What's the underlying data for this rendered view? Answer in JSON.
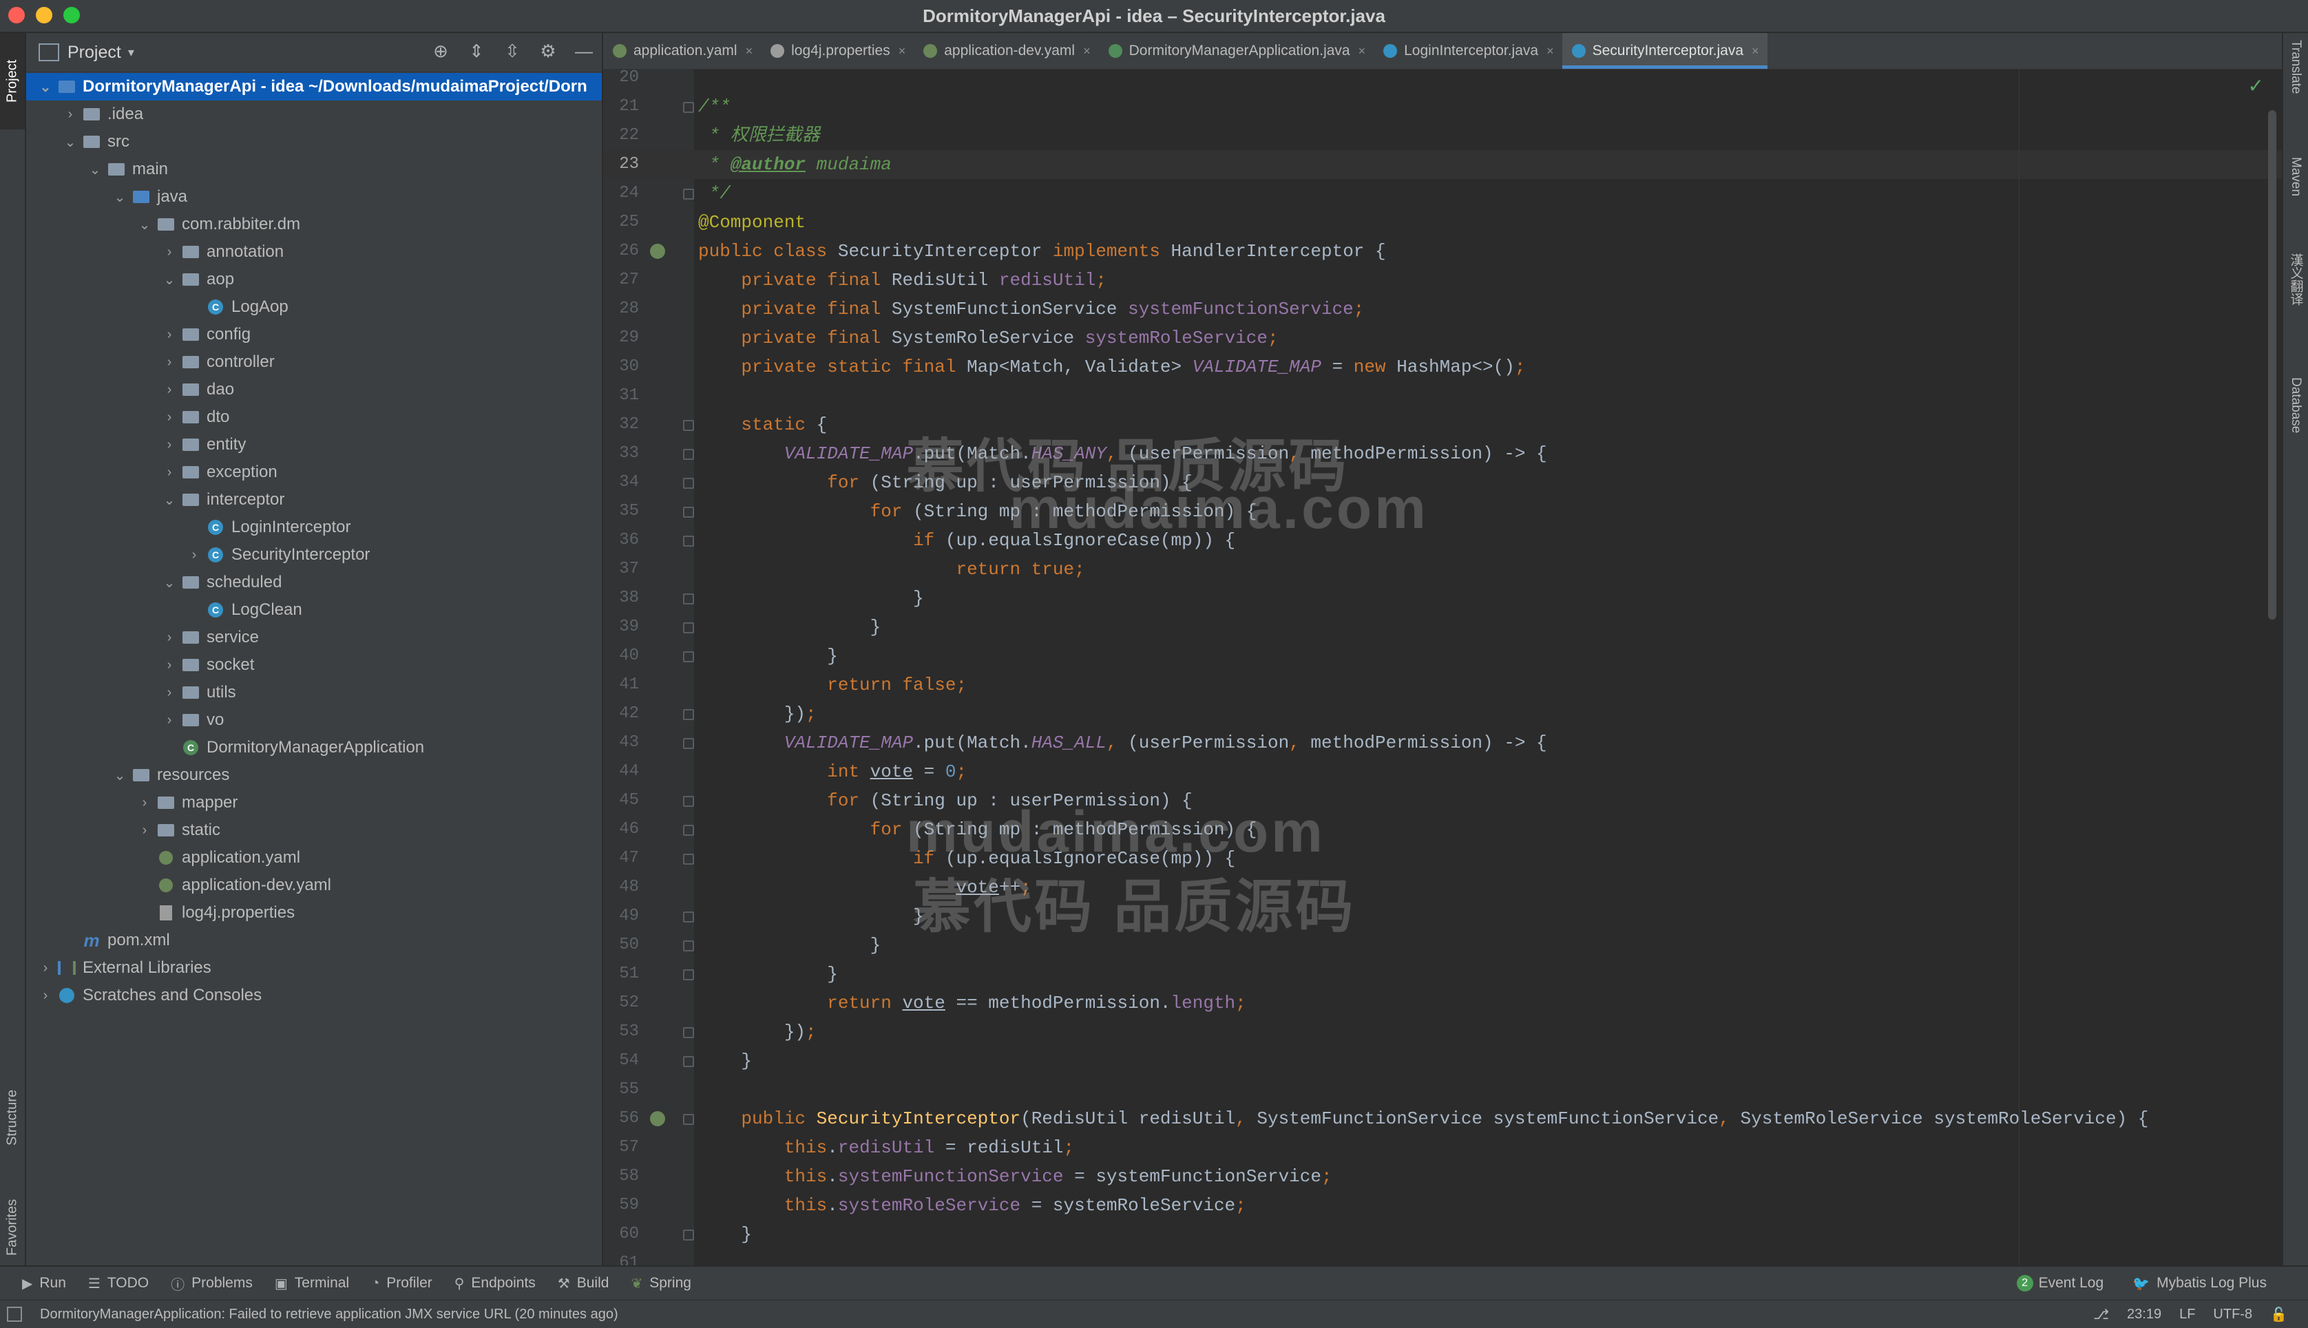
{
  "window": {
    "title": "DormitoryManagerApi - idea – SecurityInterceptor.java",
    "traffic_colors": [
      "#fe5f57",
      "#febc2e",
      "#28c840"
    ]
  },
  "left_stripe": {
    "project": "Project",
    "structure": "Structure",
    "favorites": "Favorites"
  },
  "right_stripe": {
    "translate": "Translate",
    "maven": "Maven",
    "fanyi": "漢义翻译",
    "database": "Database"
  },
  "project_panel": {
    "title": "Project",
    "tree": [
      {
        "depth": 0,
        "arrow": "open",
        "icon": "module",
        "label": "DormitoryManagerApi - idea ~/Downloads/mudaimaProject/Dorn",
        "selected": true
      },
      {
        "depth": 1,
        "arrow": "closed",
        "icon": "folder",
        "label": ".idea"
      },
      {
        "depth": 1,
        "arrow": "open",
        "icon": "folder",
        "label": "src"
      },
      {
        "depth": 2,
        "arrow": "open",
        "icon": "folder",
        "label": "main"
      },
      {
        "depth": 3,
        "arrow": "open",
        "icon": "folder-blue",
        "label": "java"
      },
      {
        "depth": 4,
        "arrow": "open",
        "icon": "folder",
        "label": "com.rabbiter.dm"
      },
      {
        "depth": 5,
        "arrow": "closed",
        "icon": "folder",
        "label": "annotation"
      },
      {
        "depth": 5,
        "arrow": "open",
        "icon": "folder",
        "label": "aop"
      },
      {
        "depth": 6,
        "arrow": "none",
        "icon": "class",
        "label": "LogAop"
      },
      {
        "depth": 5,
        "arrow": "closed",
        "icon": "folder",
        "label": "config"
      },
      {
        "depth": 5,
        "arrow": "closed",
        "icon": "folder",
        "label": "controller"
      },
      {
        "depth": 5,
        "arrow": "closed",
        "icon": "folder",
        "label": "dao"
      },
      {
        "depth": 5,
        "arrow": "closed",
        "icon": "folder",
        "label": "dto"
      },
      {
        "depth": 5,
        "arrow": "closed",
        "icon": "folder",
        "label": "entity"
      },
      {
        "depth": 5,
        "arrow": "closed",
        "icon": "folder",
        "label": "exception"
      },
      {
        "depth": 5,
        "arrow": "open",
        "icon": "folder",
        "label": "interceptor"
      },
      {
        "depth": 6,
        "arrow": "none",
        "icon": "class",
        "label": "LoginInterceptor"
      },
      {
        "depth": 6,
        "arrow": "closed",
        "icon": "class",
        "label": "SecurityInterceptor"
      },
      {
        "depth": 5,
        "arrow": "open",
        "icon": "folder",
        "label": "scheduled"
      },
      {
        "depth": 6,
        "arrow": "none",
        "icon": "class",
        "label": "LogClean"
      },
      {
        "depth": 5,
        "arrow": "closed",
        "icon": "folder",
        "label": "service"
      },
      {
        "depth": 5,
        "arrow": "closed",
        "icon": "folder",
        "label": "socket"
      },
      {
        "depth": 5,
        "arrow": "closed",
        "icon": "folder",
        "label": "utils"
      },
      {
        "depth": 5,
        "arrow": "closed",
        "icon": "folder",
        "label": "vo"
      },
      {
        "depth": 5,
        "arrow": "none",
        "icon": "spring-class",
        "label": "DormitoryManagerApplication"
      },
      {
        "depth": 3,
        "arrow": "open",
        "icon": "folder-res",
        "label": "resources"
      },
      {
        "depth": 4,
        "arrow": "closed",
        "icon": "folder",
        "label": "mapper"
      },
      {
        "depth": 4,
        "arrow": "closed",
        "icon": "folder",
        "label": "static"
      },
      {
        "depth": 4,
        "arrow": "none",
        "icon": "yaml",
        "label": "application.yaml"
      },
      {
        "depth": 4,
        "arrow": "none",
        "icon": "yaml",
        "label": "application-dev.yaml"
      },
      {
        "depth": 4,
        "arrow": "none",
        "icon": "properties",
        "label": "log4j.properties"
      },
      {
        "depth": 1,
        "arrow": "none",
        "icon": "pom",
        "label": "pom.xml"
      },
      {
        "depth": 0,
        "arrow": "closed",
        "icon": "library",
        "label": "External Libraries"
      },
      {
        "depth": 0,
        "arrow": "closed",
        "icon": "scratch",
        "label": "Scratches and Consoles"
      }
    ]
  },
  "tabs": [
    {
      "label": "application.yaml",
      "icon": "yaml",
      "active": false
    },
    {
      "label": "log4j.properties",
      "icon": "properties",
      "active": false
    },
    {
      "label": "application-dev.yaml",
      "icon": "yaml",
      "active": false
    },
    {
      "label": "DormitoryManagerApplication.java",
      "icon": "spring-class",
      "active": false
    },
    {
      "label": "LoginInterceptor.java",
      "icon": "class",
      "active": false
    },
    {
      "label": "SecurityInterceptor.java",
      "icon": "class",
      "active": true
    }
  ],
  "editor": {
    "current_line": 23,
    "lines": [
      {
        "n": 20,
        "fold": false,
        "gutter": "",
        "tokens": []
      },
      {
        "n": 21,
        "fold": true,
        "gutter": "",
        "tokens": [
          [
            "doc",
            "/**"
          ]
        ]
      },
      {
        "n": 22,
        "fold": false,
        "gutter": "",
        "tokens": [
          [
            "doc",
            " * 权限拦截器"
          ]
        ]
      },
      {
        "n": 23,
        "fold": false,
        "gutter": "",
        "tokens": [
          [
            "doc",
            " * "
          ],
          [
            "tag",
            "@author"
          ],
          [
            "doc",
            " mudaima"
          ]
        ]
      },
      {
        "n": 24,
        "fold": true,
        "gutter": "",
        "tokens": [
          [
            "doc",
            " */"
          ]
        ]
      },
      {
        "n": 25,
        "fold": false,
        "gutter": "",
        "tokens": [
          [
            "ann",
            "@Component"
          ]
        ]
      },
      {
        "n": 26,
        "fold": false,
        "gutter": "bean",
        "tokens": [
          [
            "kw",
            "public class "
          ],
          [
            "plain",
            "SecurityInterceptor "
          ],
          [
            "kw",
            "implements "
          ],
          [
            "plain",
            "HandlerInterceptor {"
          ]
        ]
      },
      {
        "n": 27,
        "fold": false,
        "gutter": "",
        "tokens": [
          [
            "plain",
            "    "
          ],
          [
            "kw",
            "private final "
          ],
          [
            "plain",
            "RedisUtil "
          ],
          [
            "fld",
            "redisUtil"
          ],
          [
            "kw",
            ";"
          ]
        ]
      },
      {
        "n": 28,
        "fold": false,
        "gutter": "",
        "tokens": [
          [
            "plain",
            "    "
          ],
          [
            "kw",
            "private final "
          ],
          [
            "plain",
            "SystemFunctionService "
          ],
          [
            "fld",
            "systemFunctionService"
          ],
          [
            "kw",
            ";"
          ]
        ]
      },
      {
        "n": 29,
        "fold": false,
        "gutter": "",
        "tokens": [
          [
            "plain",
            "    "
          ],
          [
            "kw",
            "private final "
          ],
          [
            "plain",
            "SystemRoleService "
          ],
          [
            "fld",
            "systemRoleService"
          ],
          [
            "kw",
            ";"
          ]
        ]
      },
      {
        "n": 30,
        "fold": false,
        "gutter": "",
        "tokens": [
          [
            "plain",
            "    "
          ],
          [
            "kw",
            "private static final "
          ],
          [
            "plain",
            "Map<Match, Validate> "
          ],
          [
            "sfld",
            "VALIDATE_MAP"
          ],
          [
            "plain",
            " = "
          ],
          [
            "kw",
            "new "
          ],
          [
            "plain",
            "HashMap<>()"
          ],
          [
            "kw",
            ";"
          ]
        ]
      },
      {
        "n": 31,
        "fold": false,
        "gutter": "",
        "tokens": []
      },
      {
        "n": 32,
        "fold": true,
        "gutter": "",
        "tokens": [
          [
            "plain",
            "    "
          ],
          [
            "kw",
            "static "
          ],
          [
            "plain",
            "{"
          ]
        ]
      },
      {
        "n": 33,
        "fold": true,
        "gutter": "",
        "tokens": [
          [
            "plain",
            "        "
          ],
          [
            "sfld",
            "VALIDATE_MAP"
          ],
          [
            "plain",
            ".put(Match."
          ],
          [
            "sfld",
            "HAS_ANY"
          ],
          [
            "kw",
            ", "
          ],
          [
            "plain",
            "(userPermission"
          ],
          [
            "kw",
            ", "
          ],
          [
            "plain",
            "methodPermission) -> {"
          ]
        ]
      },
      {
        "n": 34,
        "fold": true,
        "gutter": "",
        "tokens": [
          [
            "plain",
            "            "
          ],
          [
            "kw",
            "for "
          ],
          [
            "plain",
            "(String up : userPermission) {"
          ]
        ]
      },
      {
        "n": 35,
        "fold": true,
        "gutter": "",
        "tokens": [
          [
            "plain",
            "                "
          ],
          [
            "kw",
            "for "
          ],
          [
            "plain",
            "(String mp : methodPermission) {"
          ]
        ]
      },
      {
        "n": 36,
        "fold": true,
        "gutter": "",
        "tokens": [
          [
            "plain",
            "                    "
          ],
          [
            "kw",
            "if "
          ],
          [
            "plain",
            "(up.equalsIgnoreCase(mp)) {"
          ]
        ]
      },
      {
        "n": 37,
        "fold": false,
        "gutter": "",
        "tokens": [
          [
            "plain",
            "                        "
          ],
          [
            "kw",
            "return true;"
          ]
        ]
      },
      {
        "n": 38,
        "fold": true,
        "gutter": "",
        "tokens": [
          [
            "plain",
            "                    }"
          ]
        ]
      },
      {
        "n": 39,
        "fold": true,
        "gutter": "",
        "tokens": [
          [
            "plain",
            "                }"
          ]
        ]
      },
      {
        "n": 40,
        "fold": true,
        "gutter": "",
        "tokens": [
          [
            "plain",
            "            }"
          ]
        ]
      },
      {
        "n": 41,
        "fold": false,
        "gutter": "",
        "tokens": [
          [
            "plain",
            "            "
          ],
          [
            "kw",
            "return false;"
          ]
        ]
      },
      {
        "n": 42,
        "fold": true,
        "gutter": "",
        "tokens": [
          [
            "plain",
            "        })"
          ],
          [
            "kw",
            ";"
          ]
        ]
      },
      {
        "n": 43,
        "fold": true,
        "gutter": "",
        "tokens": [
          [
            "plain",
            "        "
          ],
          [
            "sfld",
            "VALIDATE_MAP"
          ],
          [
            "plain",
            ".put(Match."
          ],
          [
            "sfld",
            "HAS_ALL"
          ],
          [
            "kw",
            ", "
          ],
          [
            "plain",
            "(userPermission"
          ],
          [
            "kw",
            ", "
          ],
          [
            "plain",
            "methodPermission) -> {"
          ]
        ]
      },
      {
        "n": 44,
        "fold": false,
        "gutter": "",
        "tokens": [
          [
            "plain",
            "            "
          ],
          [
            "kw",
            "int "
          ],
          [
            "ul",
            "vote"
          ],
          [
            "plain",
            " = "
          ],
          [
            "num",
            "0"
          ],
          [
            "kw",
            ";"
          ]
        ]
      },
      {
        "n": 45,
        "fold": true,
        "gutter": "",
        "tokens": [
          [
            "plain",
            "            "
          ],
          [
            "kw",
            "for "
          ],
          [
            "plain",
            "(String up : userPermission) {"
          ]
        ]
      },
      {
        "n": 46,
        "fold": true,
        "gutter": "",
        "tokens": [
          [
            "plain",
            "                "
          ],
          [
            "kw",
            "for "
          ],
          [
            "plain",
            "(String mp : methodPermission) {"
          ]
        ]
      },
      {
        "n": 47,
        "fold": true,
        "gutter": "",
        "tokens": [
          [
            "plain",
            "                    "
          ],
          [
            "kw",
            "if "
          ],
          [
            "plain",
            "(up.equalsIgnoreCase(mp)) {"
          ]
        ]
      },
      {
        "n": 48,
        "fold": false,
        "gutter": "",
        "tokens": [
          [
            "plain",
            "                        "
          ],
          [
            "ul",
            "vote"
          ],
          [
            "plain",
            "++"
          ],
          [
            "kw",
            ";"
          ]
        ]
      },
      {
        "n": 49,
        "fold": true,
        "gutter": "",
        "tokens": [
          [
            "plain",
            "                    }"
          ]
        ]
      },
      {
        "n": 50,
        "fold": true,
        "gutter": "",
        "tokens": [
          [
            "plain",
            "                }"
          ]
        ]
      },
      {
        "n": 51,
        "fold": true,
        "gutter": "",
        "tokens": [
          [
            "plain",
            "            }"
          ]
        ]
      },
      {
        "n": 52,
        "fold": false,
        "gutter": "",
        "tokens": [
          [
            "plain",
            "            "
          ],
          [
            "kw",
            "return "
          ],
          [
            "ul",
            "vote"
          ],
          [
            "plain",
            " == methodPermission."
          ],
          [
            "fld",
            "length"
          ],
          [
            "kw",
            ";"
          ]
        ]
      },
      {
        "n": 53,
        "fold": true,
        "gutter": "",
        "tokens": [
          [
            "plain",
            "        })"
          ],
          [
            "kw",
            ";"
          ]
        ]
      },
      {
        "n": 54,
        "fold": true,
        "gutter": "",
        "tokens": [
          [
            "plain",
            "    }"
          ]
        ]
      },
      {
        "n": 55,
        "fold": false,
        "gutter": "",
        "tokens": []
      },
      {
        "n": 56,
        "fold": true,
        "gutter": "bean",
        "tokens": [
          [
            "plain",
            "    "
          ],
          [
            "kw",
            "public "
          ],
          [
            "mcall",
            "SecurityInterceptor"
          ],
          [
            "plain",
            "(RedisUtil redisUtil"
          ],
          [
            "kw",
            ", "
          ],
          [
            "plain",
            "SystemFunctionService systemFunctionService"
          ],
          [
            "kw",
            ", "
          ],
          [
            "plain",
            "SystemRoleService systemRoleService) {"
          ]
        ]
      },
      {
        "n": 57,
        "fold": false,
        "gutter": "",
        "tokens": [
          [
            "plain",
            "        "
          ],
          [
            "kw",
            "this"
          ],
          [
            "plain",
            "."
          ],
          [
            "fld",
            "redisUtil"
          ],
          [
            "plain",
            " = redisUtil"
          ],
          [
            "kw",
            ";"
          ]
        ]
      },
      {
        "n": 58,
        "fold": false,
        "gutter": "",
        "tokens": [
          [
            "plain",
            "        "
          ],
          [
            "kw",
            "this"
          ],
          [
            "plain",
            "."
          ],
          [
            "fld",
            "systemFunctionService"
          ],
          [
            "plain",
            " = systemFunctionService"
          ],
          [
            "kw",
            ";"
          ]
        ]
      },
      {
        "n": 59,
        "fold": false,
        "gutter": "",
        "tokens": [
          [
            "plain",
            "        "
          ],
          [
            "kw",
            "this"
          ],
          [
            "plain",
            "."
          ],
          [
            "fld",
            "systemRoleService"
          ],
          [
            "plain",
            " = systemRoleService"
          ],
          [
            "kw",
            ";"
          ]
        ]
      },
      {
        "n": 60,
        "fold": true,
        "gutter": "",
        "tokens": [
          [
            "plain",
            "    }"
          ]
        ]
      },
      {
        "n": 61,
        "fold": false,
        "gutter": "",
        "tokens": []
      }
    ]
  },
  "watermarks": {
    "top_cn": "慕代码 品质源码",
    "top_en": "mudaima.com",
    "bottom_en": "mudaima.com",
    "bottom_cn": "慕代码 品质源码"
  },
  "bottom_toolbar": {
    "run": "Run",
    "todo": "TODO",
    "problems": "Problems",
    "terminal": "Terminal",
    "profiler": "Profiler",
    "endpoints": "Endpoints",
    "build": "Build",
    "spring": "Spring",
    "event_log": "Event Log",
    "event_log_count": "2",
    "mybatis": "Mybatis Log Plus"
  },
  "status": {
    "message": "DormitoryManagerApplication: Failed to retrieve application JMX service URL (20 minutes ago)",
    "position": "23:19",
    "line_sep": "LF",
    "encoding": "UTF-8"
  }
}
